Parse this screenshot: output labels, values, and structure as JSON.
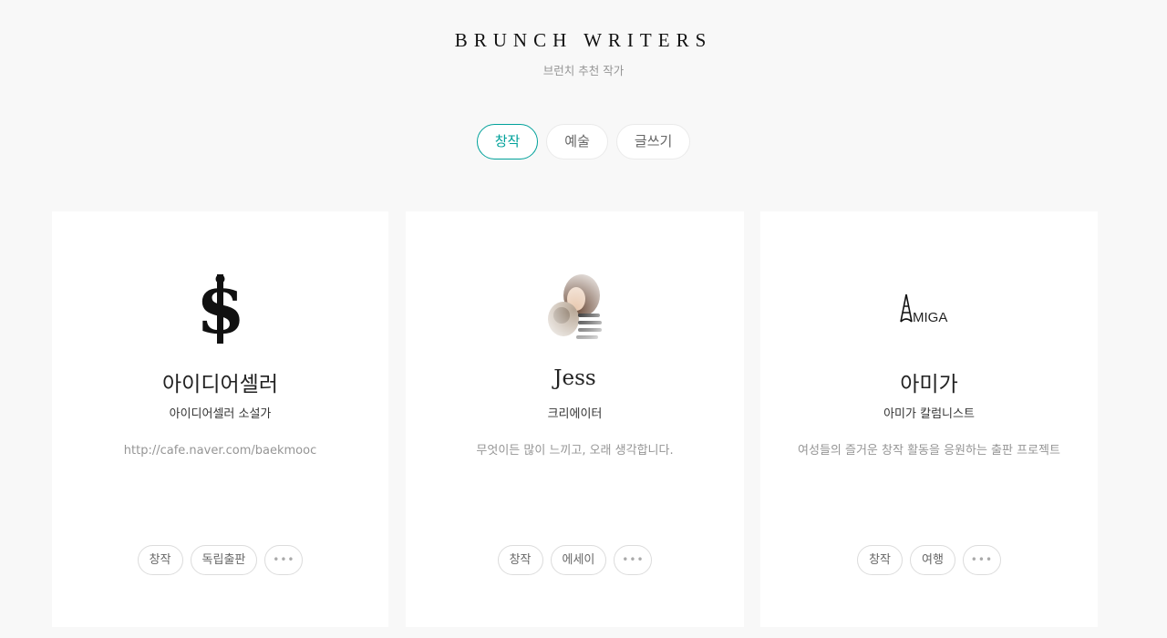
{
  "header": {
    "title": "BRUNCH WRITERS",
    "subtitle": "브런치 추천 작가"
  },
  "tabs": [
    {
      "label": "창작",
      "active": true
    },
    {
      "label": "예술",
      "active": false
    },
    {
      "label": "글쓰기",
      "active": false
    }
  ],
  "accent_color": "#00a19a",
  "writers": [
    {
      "avatar_icon": "dollar-sign-logo-icon",
      "name": "아이디어셀러",
      "role": "아이디어셀러 소설가",
      "desc": "http://cafe.naver.com/baekmooc",
      "tags": [
        "창작",
        "독립출판"
      ],
      "more": "•••"
    },
    {
      "avatar_icon": "profile-photo-icon",
      "name": "Jess",
      "role": "크리에이터",
      "desc": "무엇이든 많이 느끼고, 오래 생각합니다.",
      "tags": [
        "창작",
        "에세이"
      ],
      "more": "•••"
    },
    {
      "avatar_icon": "amiga-eiffel-logo-icon",
      "avatar_text": "MIGA",
      "name": "아미가",
      "role": "아미가 칼럼니스트",
      "desc": "여성들의 즐거운 창작 활동을 응원하는 출판 프로젝트",
      "tags": [
        "창작",
        "여행"
      ],
      "more": "•••"
    }
  ]
}
